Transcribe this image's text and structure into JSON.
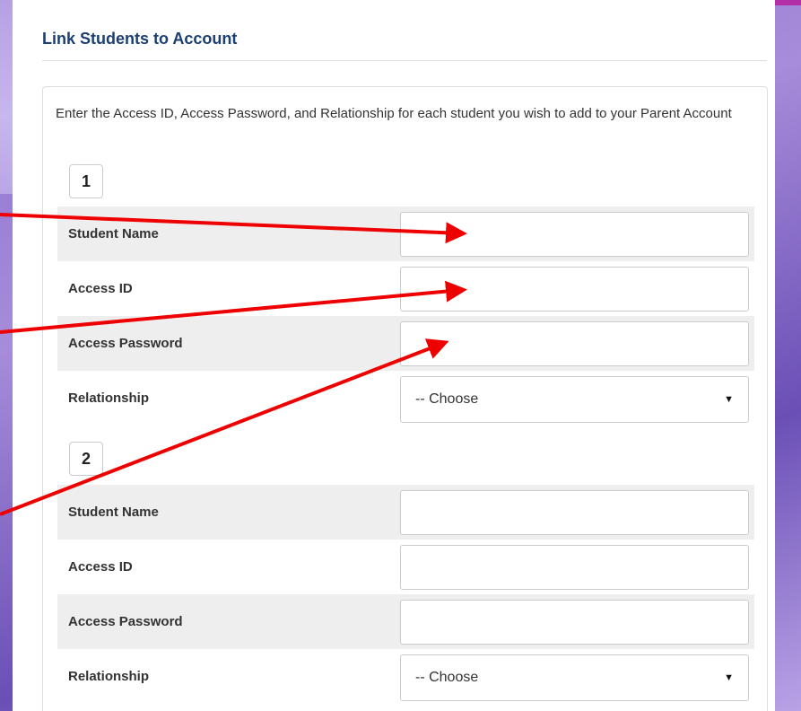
{
  "form": {
    "title": "Link Students to Account",
    "intro": "Enter the Access ID, Access Password, and Relationship for each student you wish to add to your Parent Account",
    "students": [
      {
        "number": "1",
        "student_name_label": "Student Name",
        "student_name_value": "",
        "access_id_label": "Access ID",
        "access_id_value": "",
        "access_password_label": "Access Password",
        "access_password_value": "",
        "relationship_label": "Relationship",
        "relationship_selected": "-- Choose"
      },
      {
        "number": "2",
        "student_name_label": "Student Name",
        "student_name_value": "",
        "access_id_label": "Access ID",
        "access_id_value": "",
        "access_password_label": "Access Password",
        "access_password_value": "",
        "relationship_label": "Relationship",
        "relationship_selected": "-- Choose"
      }
    ]
  },
  "colors": {
    "title": "#1c3f73",
    "row_shade": "#eeeeee",
    "annotation_arrow": "#ee0000",
    "background_purple": "#8c6fcf"
  },
  "icons": {
    "select_caret": "caret-down-icon",
    "annotation": "arrow-annotation-icon"
  }
}
